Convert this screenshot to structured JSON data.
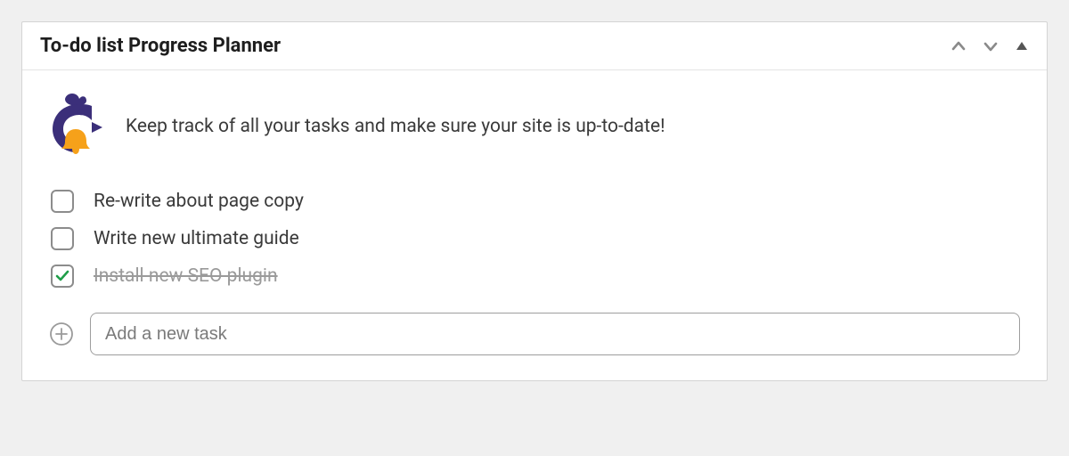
{
  "widget": {
    "title": "To-do list Progress Planner",
    "intro": "Keep track of all your tasks and make sure your site is up-to-date!"
  },
  "tasks": [
    {
      "label": "Re-write about page copy",
      "completed": false
    },
    {
      "label": "Write new ultimate guide",
      "completed": false
    },
    {
      "label": "Install new SEO plugin",
      "completed": true
    }
  ],
  "addTask": {
    "placeholder": "Add a new task"
  },
  "icons": {
    "chevronUp": "chevron-up-icon",
    "chevronDown": "chevron-down-icon",
    "triangleUp": "triangle-up-icon",
    "plus": "plus-icon",
    "logo": "progress-planner-logo"
  },
  "colors": {
    "purple": "#3b2f7a",
    "orange": "#f6a11a",
    "green": "#1f9e49"
  }
}
